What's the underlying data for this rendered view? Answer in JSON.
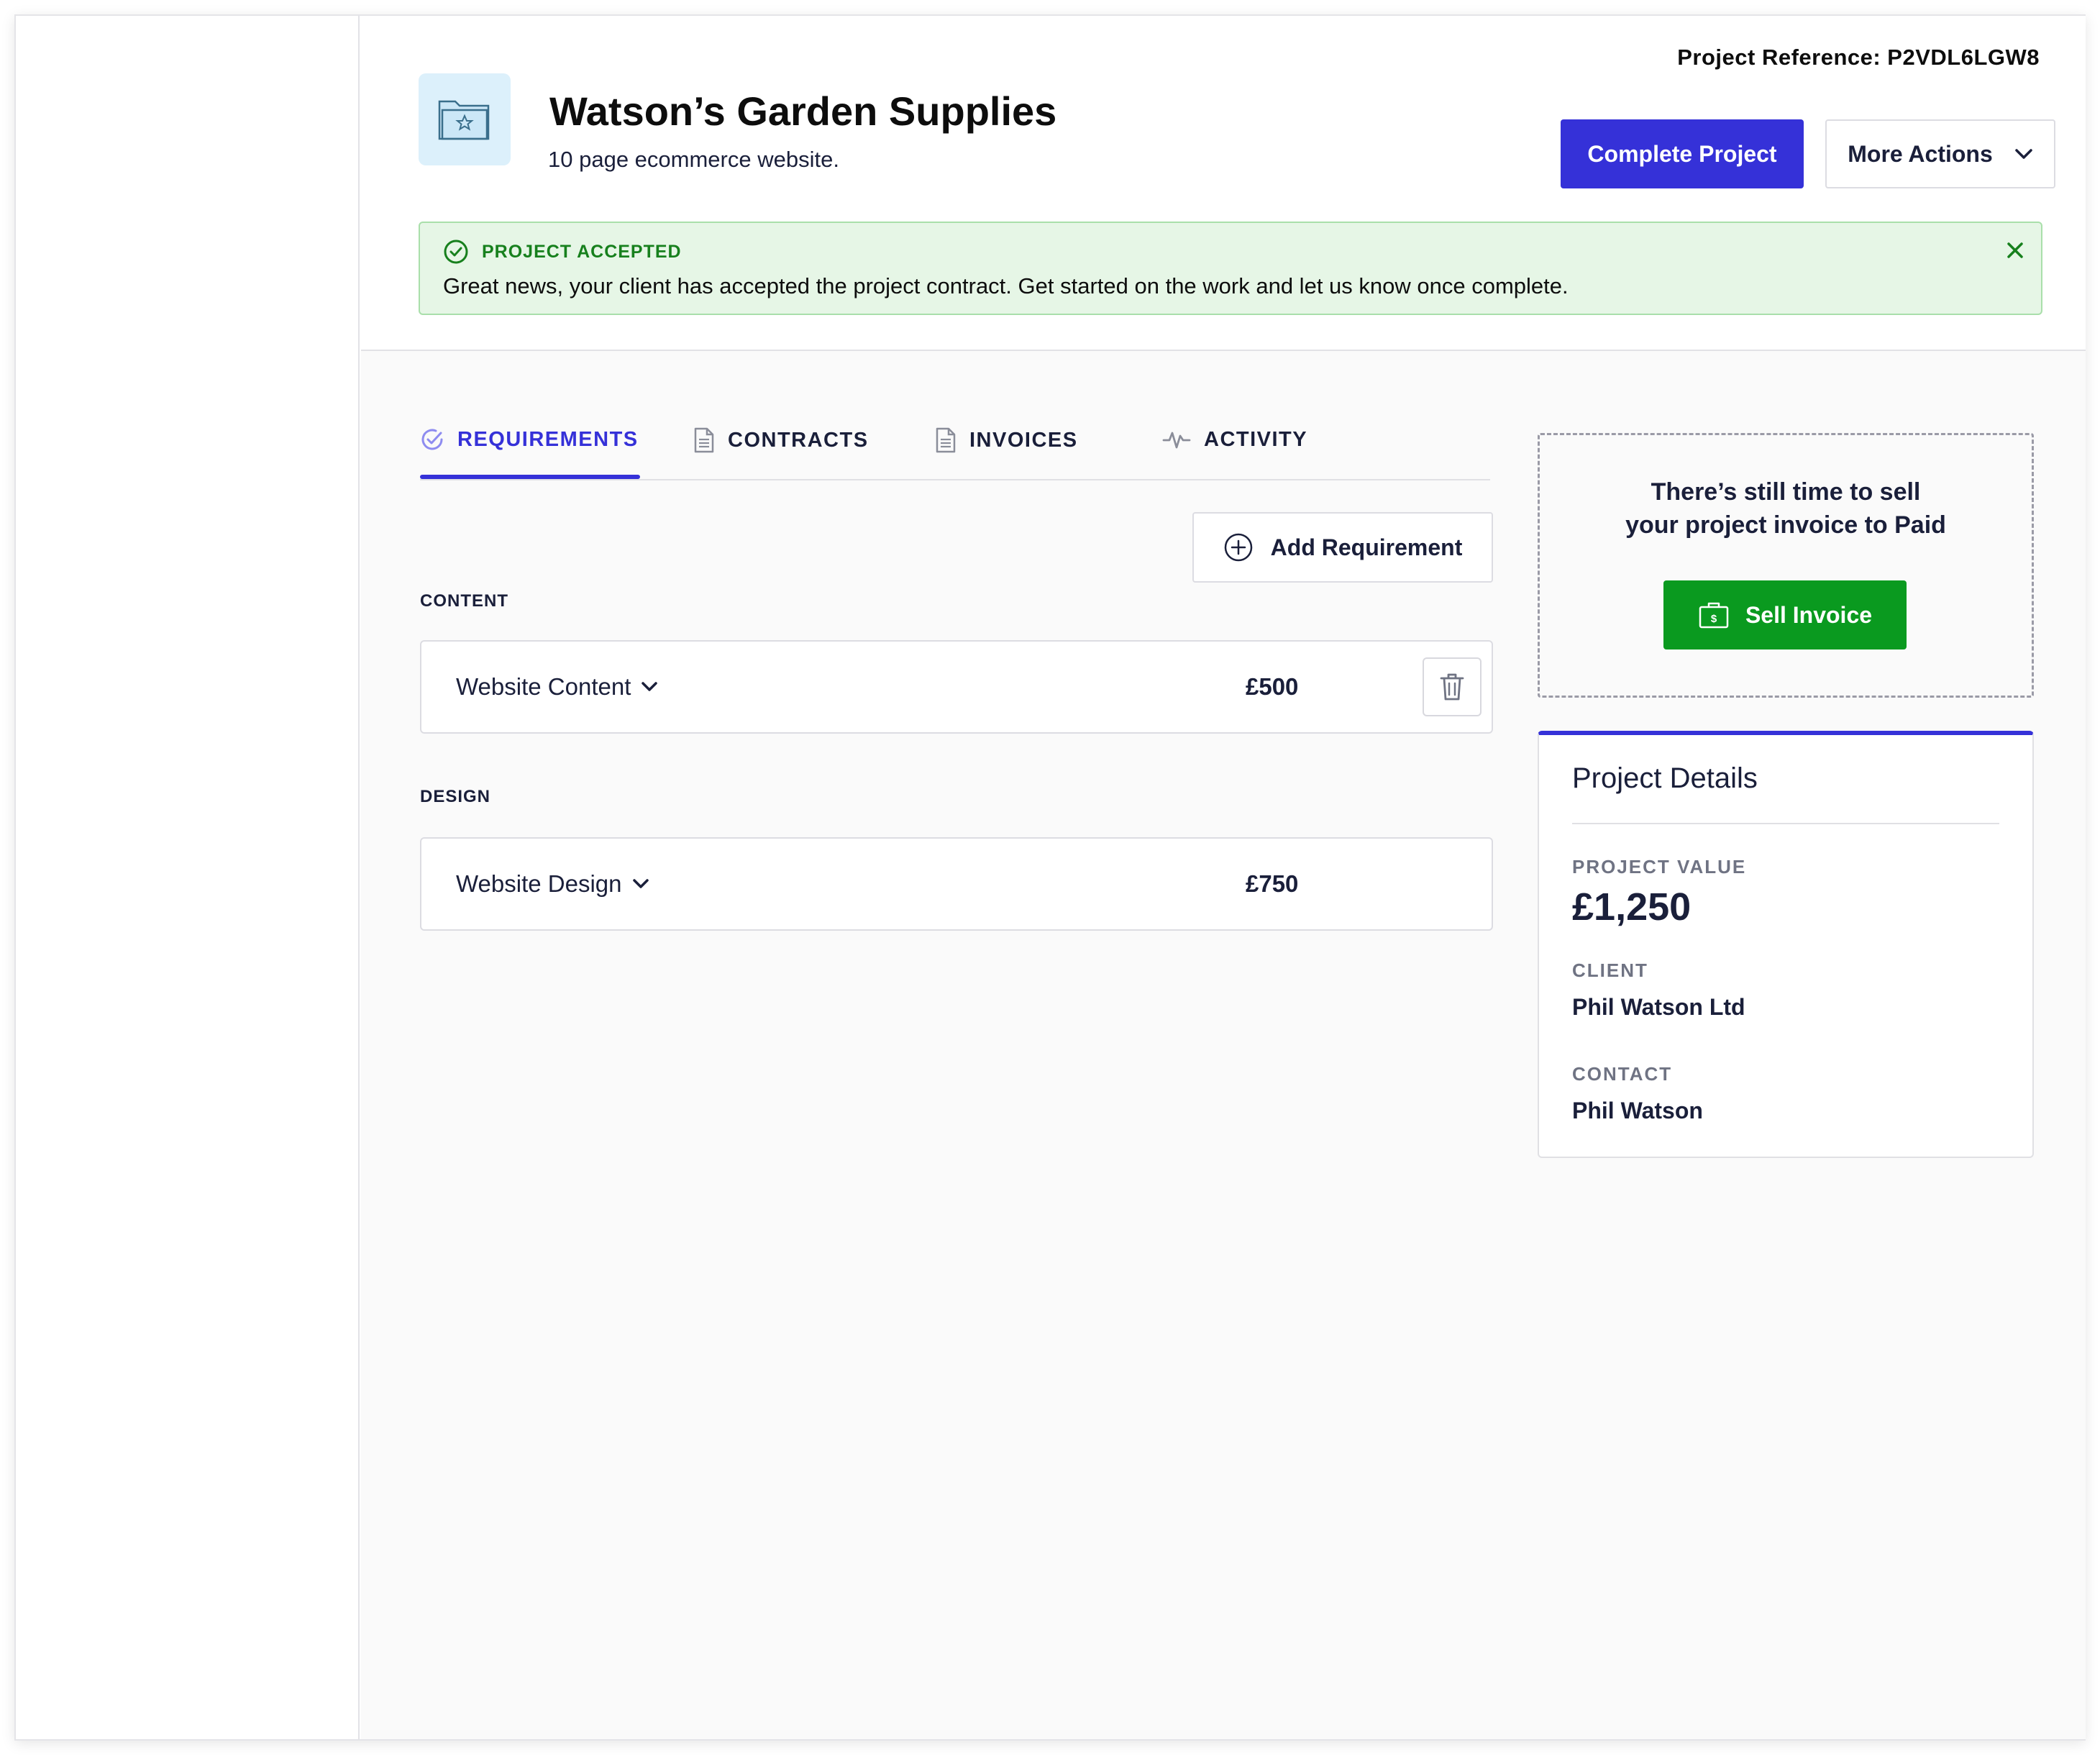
{
  "header": {
    "project_reference": "Project Reference: P2VDL6LGW8",
    "title": "Watson’s Garden Supplies",
    "subtitle": "10 page ecommerce website.",
    "complete_button": "Complete Project",
    "more_actions_button": "More Actions"
  },
  "alert": {
    "title": "PROJECT ACCEPTED",
    "message": "Great news, your client has accepted the project contract. Get started on the work and let us know once complete."
  },
  "tabs": [
    {
      "label": "REQUIREMENTS",
      "icon": "check-circle-icon",
      "active": true
    },
    {
      "label": "CONTRACTS",
      "icon": "document-icon",
      "active": false
    },
    {
      "label": "INVOICES",
      "icon": "document-icon",
      "active": false
    },
    {
      "label": "ACTIVITY",
      "icon": "pulse-icon",
      "active": false
    }
  ],
  "add_requirement_button": "Add Requirement",
  "requirements": [
    {
      "section": "CONTENT",
      "name": "Website Content",
      "price": "£500",
      "has_delete": true
    },
    {
      "section": "DESIGN",
      "name": "Website Design",
      "price": "£750",
      "has_delete": false
    }
  ],
  "sell_box": {
    "line1": "There’s still time to sell",
    "line2": "your project invoice to Paid",
    "button": "Sell Invoice"
  },
  "details": {
    "title": "Project Details",
    "value_label": "PROJECT VALUE",
    "value": "£1,250",
    "client_label": "CLIENT",
    "client": "Phil Watson Ltd",
    "contact_label": "CONTACT",
    "contact": "Phil Watson"
  },
  "colors": {
    "accent": "#3531d8",
    "success": "#0a9a1f",
    "alert_bg": "#e6f6e6",
    "alert_text": "#17801d"
  }
}
